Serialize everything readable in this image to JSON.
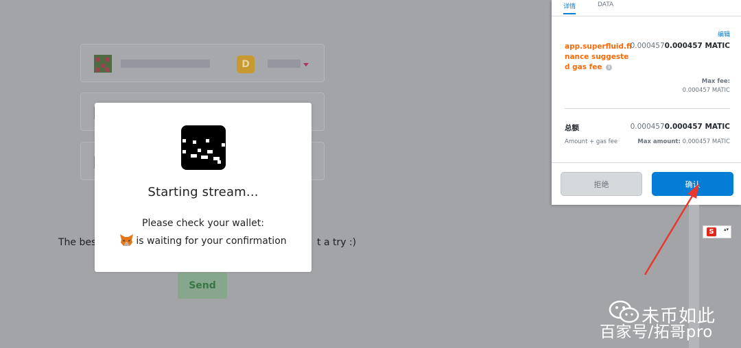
{
  "background": {
    "promo_text_left": "The best",
    "promo_text_right": "t a try :)",
    "send_label": "Send",
    "token_glyph": "D"
  },
  "modal": {
    "title": "Starting stream...",
    "check_wallet": "Please check your wallet:",
    "waiting": "is waiting for your confirmation"
  },
  "metamask": {
    "tabs": [
      "详情",
      "DATA"
    ],
    "edit_label": "编辑",
    "origin": "app.superfluid.finance suggested gas fee",
    "gas_value_muted": "0.000457",
    "gas_value_strong": "0.000457 MATIC",
    "max_fee_label": "Max fee:",
    "max_fee_value": "0.000457 MATIC",
    "total_label": "总额",
    "total_value_muted": "0.000457",
    "total_value_strong": "0.000457 MATIC",
    "amount_gas_label": "Amount + gas fee",
    "max_amount_label": "Max amount:",
    "max_amount_value": "0.000457 MATIC",
    "reject_label": "拒绝",
    "confirm_label": "确认"
  },
  "widgets": {
    "lang_glyph": "S",
    "lang_arrows": "▴▾"
  },
  "watermark": {
    "line1": "未币如此",
    "line2": "百家号/拓哥pro"
  },
  "colors": {
    "metamask_blue": "#037dd6",
    "origin_orange": "#f66a0a",
    "annotation_red": "#e8372c",
    "overlay_grey": "#a3a4a8"
  },
  "icons": {
    "modal_logo": "superfluid-logo-icon",
    "wallet": "metamask-fox-icon",
    "info": "info-icon",
    "watermark": "wechat-icon"
  }
}
